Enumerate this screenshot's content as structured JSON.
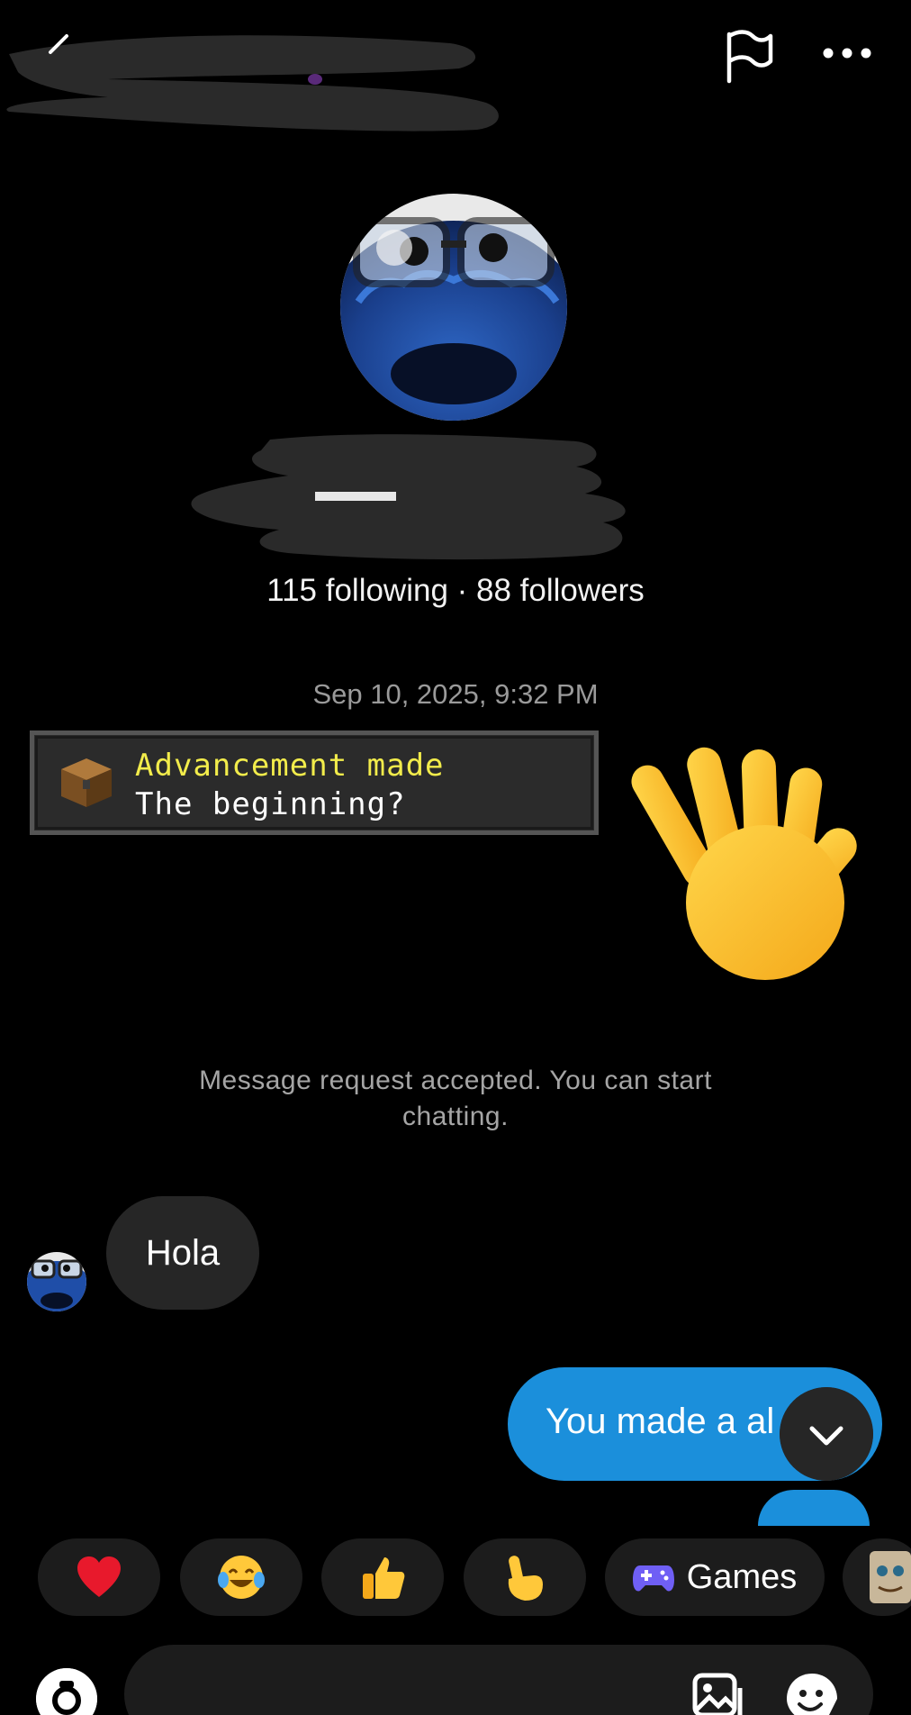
{
  "profile": {
    "stats": "115 following · 88 followers"
  },
  "thread": {
    "timestamp": "Sep 10, 2025, 9:32 PM",
    "advancement": {
      "title": "Advancement made",
      "subtitle": "The beginning?"
    },
    "system_message": "Message request accepted. You can start chatting.",
    "messages": [
      {
        "from": "them",
        "text": "Hola"
      },
      {
        "from": "me",
        "text": "You made a al"
      }
    ]
  },
  "quick_reactions": {
    "games_label": "Games"
  },
  "colors": {
    "background": "#000000",
    "incoming_bubble": "#262626",
    "outgoing_bubble": "#1b8fdb",
    "advancement_title": "#f2ec4b"
  }
}
